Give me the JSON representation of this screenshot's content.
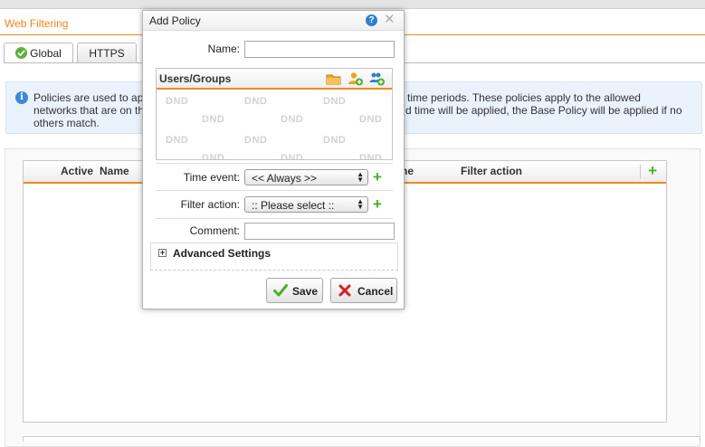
{
  "page": {
    "title": "Web Filtering",
    "tabs": [
      {
        "label": "Global",
        "icon": "check-circle-icon"
      },
      {
        "label": "HTTPS"
      }
    ]
  },
  "info": {
    "text_left_line1": "Policies are used to ap",
    "text_left_line2": "networks that are on th",
    "text_right_line1": "or time periods. These policies apply to the allowed",
    "text_right_line2": "d time will be applied, the Base Policy will be applied if no",
    "text_line3": "others match."
  },
  "grid": {
    "columns": {
      "active": "Active",
      "name": "Name",
      "time_suffix": "ne",
      "filter_action": "Filter action"
    },
    "add_icon": "plus-icon"
  },
  "dialog": {
    "title": "Add Policy",
    "name_label": "Name:",
    "name_value": "",
    "users_groups_title": "Users/Groups",
    "dnd_text": "DND",
    "time_event_label": "Time event:",
    "time_event_value": "<< Always >>",
    "filter_action_label": "Filter action:",
    "filter_action_value": ":: Please select ::",
    "comment_label": "Comment:",
    "comment_value": "",
    "advanced_label": "Advanced Settings",
    "advanced_toggle": "+",
    "save_label": "Save",
    "cancel_label": "Cancel"
  },
  "colors": {
    "accent_orange": "#ef8a1f",
    "add_green": "#4caf28",
    "info_blue": "#3a8ad6",
    "cancel_red": "#d42121"
  }
}
